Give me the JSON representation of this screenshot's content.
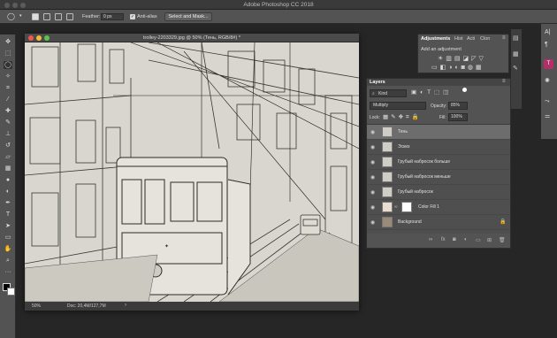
{
  "window": {
    "app_title": "Adobe Photoshop CC 2018"
  },
  "options": {
    "feather_label": "Feather:",
    "feather_value": "0 px",
    "antialias_label": "Anti-alias",
    "antialias_checked": "✓",
    "select_mask_label": "Select and Mask..."
  },
  "document": {
    "title": "trolley-2203329.jpg @ 50% (Тень, RGB/8#) *",
    "zoom": "50%",
    "doc_info": "Doc: 20,4M/127,7M"
  },
  "adjustments": {
    "tabs": [
      "Adjustments",
      "Hist",
      "Acti",
      "Clon"
    ],
    "hint": "Add an adjustment"
  },
  "layers": {
    "title": "Layers",
    "kind_label": "Kind",
    "blend_mode": "Multiply",
    "opacity_label": "Opacity:",
    "opacity_value": "85%",
    "lock_label": "Lock:",
    "fill_label": "Fill:",
    "fill_value": "100%",
    "items": [
      {
        "name": "Тень"
      },
      {
        "name": "Эскиз"
      },
      {
        "name": "Грубый набросок больше"
      },
      {
        "name": "Грубый набросок меньше"
      },
      {
        "name": "Грубый набросок"
      },
      {
        "name": "Color Fill 1"
      },
      {
        "name": "Background"
      }
    ]
  },
  "colors": {
    "selected_layer": "#6d6d6d",
    "panel": "#535353",
    "chrome": "#3a3a3a"
  }
}
